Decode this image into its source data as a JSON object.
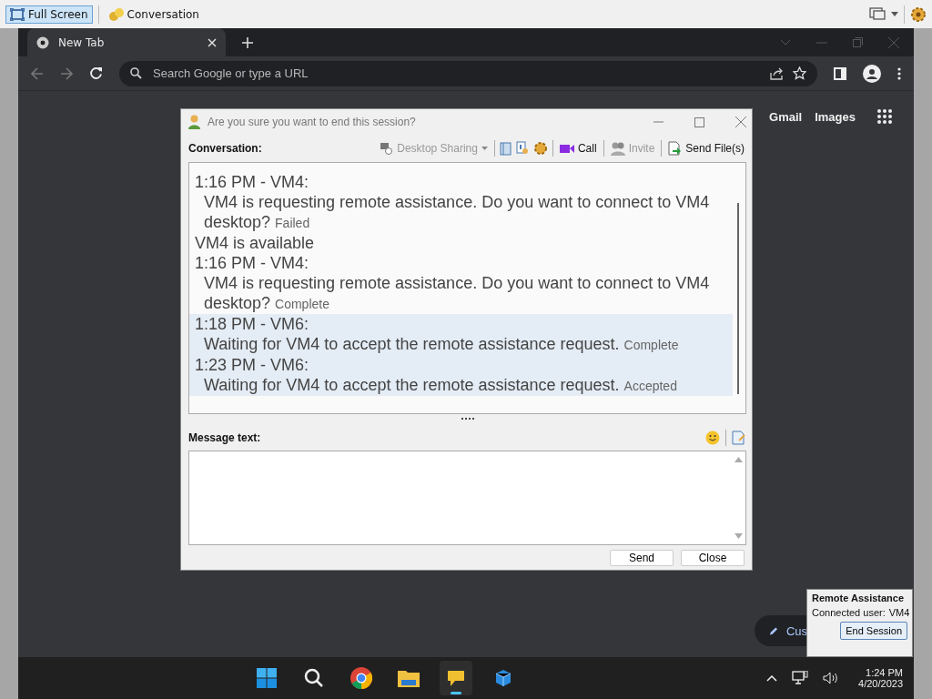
{
  "host_bar": {
    "items": [
      {
        "label": "Full Screen",
        "selected": true
      },
      {
        "label": "Conversation",
        "selected": false
      }
    ]
  },
  "browser": {
    "tab": {
      "title": "New Tab"
    },
    "address": {
      "placeholder": "Search Google or type a URL"
    },
    "links": [
      "Gmail",
      "Images"
    ],
    "customize": "Cus"
  },
  "dialog": {
    "title": "Are you sure you want to end this session?",
    "label": "Conversation:",
    "toolbar": [
      {
        "kind": "dropdown",
        "label": "Desktop Sharing",
        "disabled": true
      },
      {
        "kind": "icon"
      },
      {
        "kind": "icon"
      },
      {
        "kind": "icon"
      },
      {
        "kind": "button",
        "label": "Call",
        "disabled": false
      },
      {
        "kind": "button",
        "label": "Invite",
        "disabled": true
      },
      {
        "kind": "button",
        "label": "Send File(s)",
        "disabled": false
      }
    ],
    "messages": [
      {
        "kind": "message",
        "header": "1:16 PM - VM4:",
        "text": "VM4 is requesting remote assistance. Do you want to connect to VM4 desktop?",
        "status": "Failed",
        "highlighted": false
      },
      {
        "kind": "notice",
        "text": "VM4 is available",
        "highlighted": false
      },
      {
        "kind": "message",
        "header": "1:16 PM - VM4:",
        "text": "VM4 is requesting remote assistance. Do you want to connect to VM4 desktop?",
        "status": "Complete",
        "highlighted": false
      },
      {
        "kind": "message",
        "header": "1:18 PM - VM6:",
        "text": "Waiting for VM4 to accept the remote assistance request.",
        "status": "Complete",
        "highlighted": true
      },
      {
        "kind": "message",
        "header": "1:23 PM - VM6:",
        "text": "Waiting for VM4 to accept the remote assistance request.",
        "status": "Accepted",
        "highlighted": true
      }
    ],
    "message_label": "Message text:",
    "buttons": [
      "Send",
      "Close"
    ]
  },
  "popup": {
    "title": "Remote Assistance",
    "label": "Connected user:",
    "user": "VM4",
    "button": "End Session"
  },
  "taskbar": {
    "apps": [
      {
        "kind": "start",
        "selected": false
      },
      {
        "kind": "search",
        "selected": false
      },
      {
        "kind": "browser",
        "selected": false
      },
      {
        "kind": "folder",
        "selected": false
      },
      {
        "kind": "chat",
        "selected": true
      },
      {
        "kind": "remote",
        "selected": false
      }
    ],
    "time": "1:24 PM",
    "date": "4/20/2023"
  }
}
